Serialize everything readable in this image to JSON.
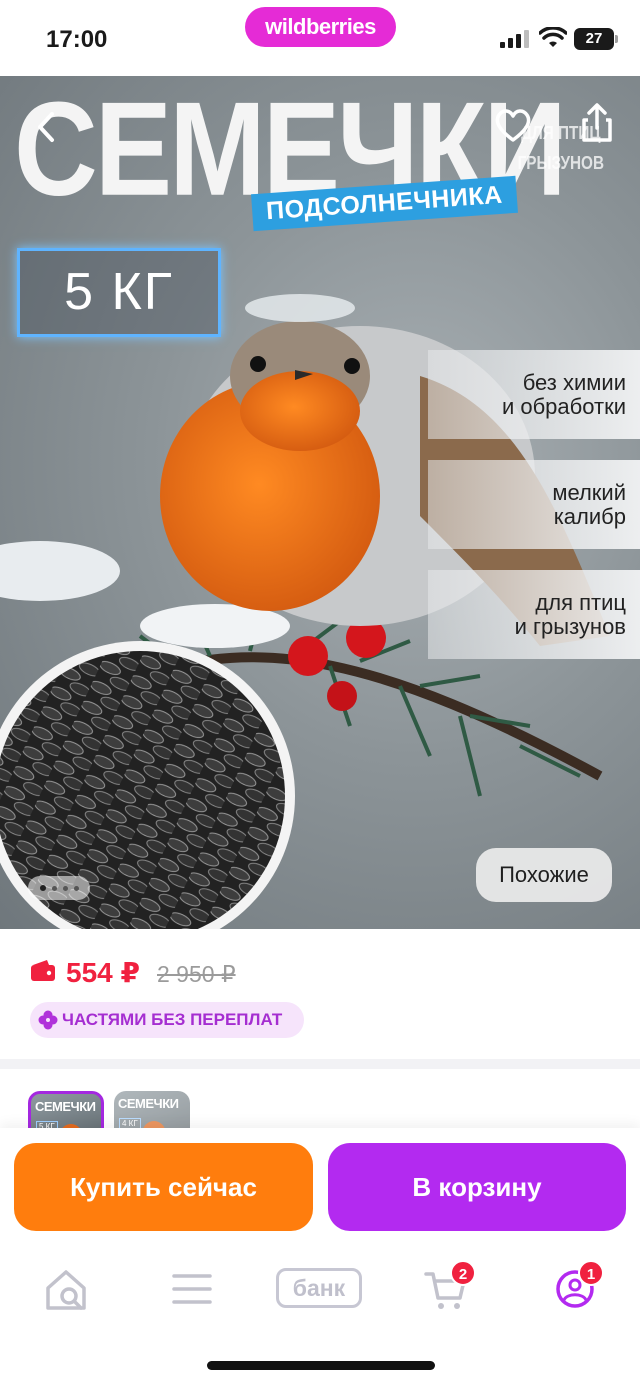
{
  "status_bar": {
    "time": "17:00",
    "brand": "wildberries",
    "battery": "27"
  },
  "hero": {
    "title": "СЕМЕЧКИ",
    "subtitle": "ПОДСОЛНЕЧНИКА",
    "weight": "5 КГ",
    "ghost_line1": "ДЛЯ ПТИЦ",
    "ghost_line2": "ГРЫЗУНОВ",
    "features": [
      {
        "line1": "без химии",
        "line2": "и обработки"
      },
      {
        "line1": "мелкий",
        "line2": "калибр"
      },
      {
        "line1": "для птиц",
        "line2": "и грызунов"
      }
    ],
    "similar_label": "Похожие",
    "icons": {
      "back": "chevron-left-icon",
      "favorite": "heart-icon",
      "share": "share-icon"
    }
  },
  "price": {
    "current": "554 ₽",
    "old": "2 950 ₽",
    "installments": "ЧАСТЯМИ БЕЗ ПЕРЕПЛАТ",
    "accent_color": "#f0213f"
  },
  "variants": [
    {
      "title": "СЕМЕЧКИ",
      "weight": "5 КГ"
    },
    {
      "title": "СЕМЕЧКИ",
      "weight": "4 КГ"
    }
  ],
  "actions": {
    "buy_now": "Купить сейчас",
    "add_to_cart": "В корзину",
    "buy_color": "#ff7d0d",
    "cart_color": "#b32af0"
  },
  "tabbar": {
    "bank_label": "банк",
    "cart_badge": "2",
    "profile_badge": "1"
  }
}
